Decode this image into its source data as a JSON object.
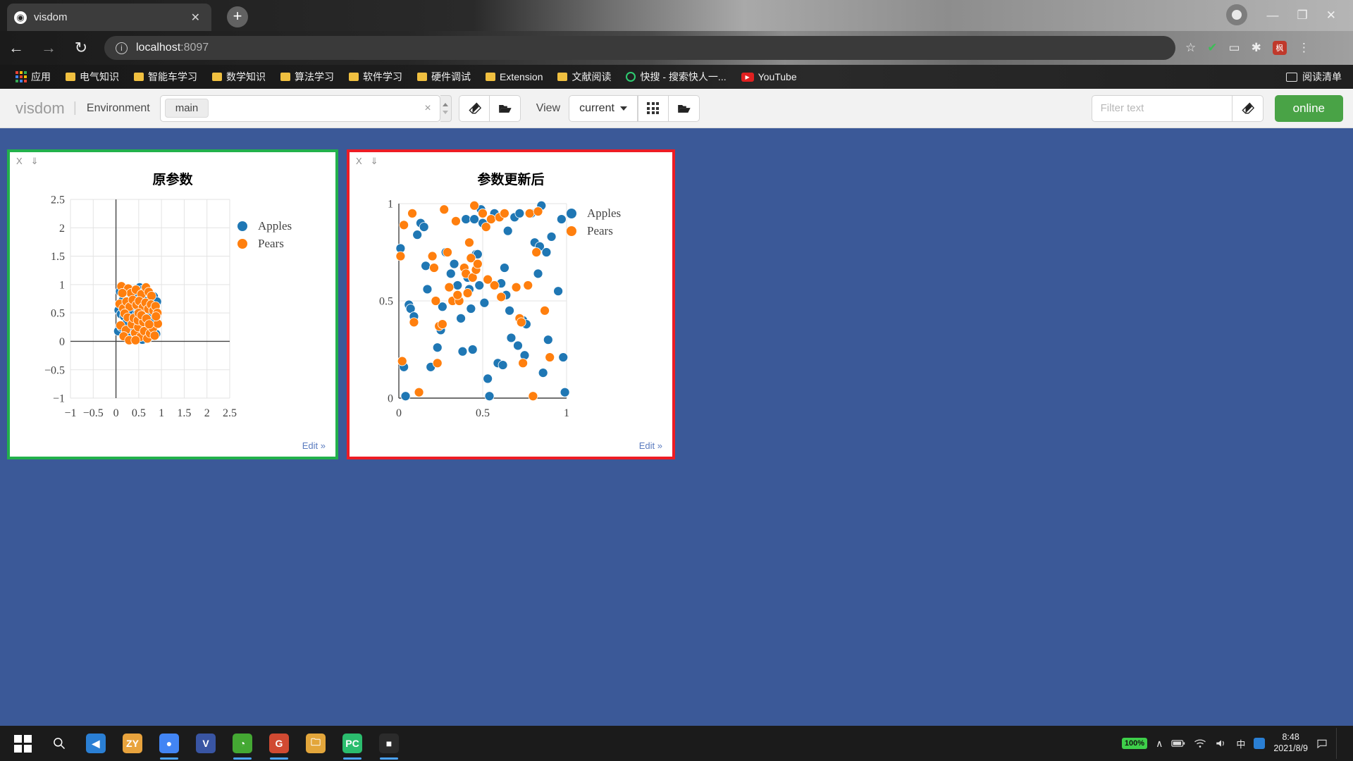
{
  "browser": {
    "tab": {
      "title": "visdom",
      "favicon": "visdom-globe-icon",
      "close": "✕"
    },
    "newtab_label": "+",
    "window_controls": {
      "minimize": "—",
      "maximize": "❐",
      "close": "✕"
    },
    "nav": {
      "back": "←",
      "forward": "→",
      "reload": "↻"
    },
    "omnibox": {
      "info": "ⓘ",
      "host": "localhost",
      "port": ":8097"
    },
    "nav_right": {
      "star": "☆",
      "shield": "✔",
      "cast": "▭",
      "extensions": "✱",
      "profile_badge": "枫",
      "menu": "⋮"
    },
    "bookmarks": [
      {
        "label": "应用",
        "icon": "apps-grid-icon"
      },
      {
        "label": "电气知识",
        "icon": "folder-icon"
      },
      {
        "label": "智能车学习",
        "icon": "folder-icon"
      },
      {
        "label": "数学知识",
        "icon": "folder-icon"
      },
      {
        "label": "算法学习",
        "icon": "folder-icon"
      },
      {
        "label": "软件学习",
        "icon": "folder-icon"
      },
      {
        "label": "硬件调试",
        "icon": "folder-icon"
      },
      {
        "label": "Extension",
        "icon": "folder-icon"
      },
      {
        "label": "文献阅读",
        "icon": "folder-icon"
      },
      {
        "label": "快搜 - 搜索快人一...",
        "icon": "quicksearch-icon"
      },
      {
        "label": "YouTube",
        "icon": "youtube-icon"
      }
    ],
    "reading_list": "阅读清单"
  },
  "visdom": {
    "logo": "visdom",
    "separator": "|",
    "environment_label": "Environment",
    "environment_value": "main",
    "clear_token": "×",
    "eraser_icon": "eraser-icon",
    "folder_icon": "folder-open-icon",
    "view_label": "View",
    "view_value": "current",
    "grid_icon": "grid-icon",
    "view_folder_icon": "folder-open-icon",
    "filter_placeholder": "Filter text",
    "filter_value": "",
    "filter_eraser_icon": "eraser-icon",
    "status_label": "online",
    "status_color": "#49a346"
  },
  "panels": [
    {
      "border_color": "#22b14c",
      "close_label": "X",
      "save_label": "⇓",
      "edit_label": "Edit »",
      "chart_index": 0
    },
    {
      "border_color": "#ed1c24",
      "close_label": "X",
      "save_label": "⇓",
      "edit_label": "Edit »",
      "chart_index": 1
    }
  ],
  "chart_data": [
    {
      "type": "scatter",
      "title": "原参数",
      "xlabel": "",
      "ylabel": "",
      "xlim": [
        -1,
        2.5
      ],
      "ylim": [
        -1,
        2.5
      ],
      "xticks": [
        "−1",
        "−0.5",
        "0",
        "0.5",
        "1",
        "1.5",
        "2",
        "2.5"
      ],
      "yticks": [
        "−1",
        "−0.5",
        "0",
        "0.5",
        "1",
        "1.5",
        "2",
        "2.5"
      ],
      "grid": true,
      "legend_position": "right",
      "legend": [
        {
          "name": "Apples",
          "color": "#1f77b4"
        },
        {
          "name": "Pears",
          "color": "#ff7f0e"
        }
      ],
      "series": [
        {
          "name": "Apples",
          "color": "#1f77b4",
          "points": [
            [
              0.09,
              0.88
            ],
            [
              0.21,
              0.93
            ],
            [
              0.29,
              0.86
            ],
            [
              0.34,
              0.81
            ],
            [
              0.41,
              0.77
            ],
            [
              0.52,
              0.95
            ],
            [
              0.57,
              0.9
            ],
            [
              0.64,
              0.88
            ],
            [
              0.06,
              0.55
            ],
            [
              0.11,
              0.48
            ],
            [
              0.14,
              0.62
            ],
            [
              0.18,
              0.44
            ],
            [
              0.24,
              0.57
            ],
            [
              0.27,
              0.5
            ],
            [
              0.31,
              0.66
            ],
            [
              0.36,
              0.53
            ],
            [
              0.43,
              0.62
            ],
            [
              0.47,
              0.49
            ],
            [
              0.5,
              0.58
            ],
            [
              0.55,
              0.44
            ],
            [
              0.6,
              0.52
            ],
            [
              0.66,
              0.47
            ],
            [
              0.7,
              0.56
            ],
            [
              0.74,
              0.43
            ],
            [
              0.05,
              0.18
            ],
            [
              0.12,
              0.25
            ],
            [
              0.2,
              0.12
            ],
            [
              0.28,
              0.22
            ],
            [
              0.33,
              0.09
            ],
            [
              0.4,
              0.17
            ],
            [
              0.46,
              0.06
            ],
            [
              0.53,
              0.14
            ],
            [
              0.58,
              0.03
            ],
            [
              0.63,
              0.11
            ],
            [
              0.68,
              0.2
            ],
            [
              0.72,
              0.07
            ],
            [
              0.76,
              0.33
            ],
            [
              0.8,
              0.26
            ],
            [
              0.84,
              0.39
            ],
            [
              0.88,
              0.13
            ],
            [
              0.15,
              0.72
            ],
            [
              0.38,
              0.84
            ],
            [
              0.61,
              0.72
            ],
            [
              0.79,
              0.63
            ],
            [
              0.83,
              0.79
            ],
            [
              0.86,
              0.52
            ],
            [
              0.9,
              0.7
            ],
            [
              0.25,
              0.35
            ]
          ]
        },
        {
          "name": "Pears",
          "color": "#ff7f0e",
          "points": [
            [
              0.12,
              0.97
            ],
            [
              0.27,
              0.93
            ],
            [
              0.33,
              0.85
            ],
            [
              0.44,
              0.91
            ],
            [
              0.56,
              0.83
            ],
            [
              0.66,
              0.95
            ],
            [
              0.72,
              0.87
            ],
            [
              0.78,
              0.8
            ],
            [
              0.08,
              0.66
            ],
            [
              0.16,
              0.58
            ],
            [
              0.23,
              0.7
            ],
            [
              0.3,
              0.61
            ],
            [
              0.37,
              0.73
            ],
            [
              0.45,
              0.64
            ],
            [
              0.51,
              0.71
            ],
            [
              0.59,
              0.6
            ],
            [
              0.65,
              0.68
            ],
            [
              0.71,
              0.57
            ],
            [
              0.77,
              0.65
            ],
            [
              0.82,
              0.54
            ],
            [
              0.87,
              0.62
            ],
            [
              0.91,
              0.5
            ],
            [
              0.19,
              0.49
            ],
            [
              0.26,
              0.42
            ],
            [
              0.1,
              0.28
            ],
            [
              0.22,
              0.2
            ],
            [
              0.35,
              0.3
            ],
            [
              0.42,
              0.15
            ],
            [
              0.49,
              0.25
            ],
            [
              0.54,
              0.08
            ],
            [
              0.62,
              0.18
            ],
            [
              0.69,
              0.05
            ],
            [
              0.75,
              0.14
            ],
            [
              0.81,
              0.23
            ],
            [
              0.85,
              0.1
            ],
            [
              0.92,
              0.31
            ],
            [
              0.17,
              0.09
            ],
            [
              0.39,
              0.41
            ],
            [
              0.48,
              0.37
            ],
            [
              0.6,
              0.34
            ],
            [
              0.14,
              0.85
            ],
            [
              0.5,
              0.5
            ],
            [
              0.56,
              0.46
            ],
            [
              0.67,
              0.4
            ],
            [
              0.73,
              0.3
            ],
            [
              0.88,
              0.44
            ],
            [
              0.29,
              0.02
            ],
            [
              0.43,
              0.02
            ]
          ]
        }
      ]
    },
    {
      "type": "scatter",
      "title": "参数更新后",
      "xlabel": "",
      "ylabel": "",
      "xlim": [
        0,
        1
      ],
      "ylim": [
        0,
        1
      ],
      "xticks": [
        "0",
        "0.5",
        "1"
      ],
      "yticks": [
        "0",
        "0.5",
        "1"
      ],
      "grid": true,
      "legend_position": "right",
      "legend": [
        {
          "name": "Apples",
          "color": "#1f77b4"
        },
        {
          "name": "Pears",
          "color": "#ff7f0e"
        }
      ],
      "series": [
        {
          "name": "Apples",
          "color": "#1f77b4",
          "points": [
            [
              0.01,
              0.77
            ],
            [
              0.03,
              0.16
            ],
            [
              0.04,
              0.01
            ],
            [
              0.06,
              0.48
            ],
            [
              0.07,
              0.46
            ],
            [
              0.09,
              0.42
            ],
            [
              0.11,
              0.84
            ],
            [
              0.13,
              0.9
            ],
            [
              0.15,
              0.88
            ],
            [
              0.16,
              0.68
            ],
            [
              0.17,
              0.56
            ],
            [
              0.19,
              0.16
            ],
            [
              0.23,
              0.26
            ],
            [
              0.26,
              0.47
            ],
            [
              0.28,
              0.75
            ],
            [
              0.31,
              0.64
            ],
            [
              0.35,
              0.58
            ],
            [
              0.37,
              0.41
            ],
            [
              0.38,
              0.24
            ],
            [
              0.4,
              0.92
            ],
            [
              0.41,
              0.62
            ],
            [
              0.42,
              0.56
            ],
            [
              0.43,
              0.46
            ],
            [
              0.44,
              0.25
            ],
            [
              0.45,
              0.92
            ],
            [
              0.46,
              0.74
            ],
            [
              0.47,
              0.74
            ],
            [
              0.48,
              0.58
            ],
            [
              0.49,
              0.97
            ],
            [
              0.5,
              0.9
            ],
            [
              0.51,
              0.49
            ],
            [
              0.53,
              0.1
            ],
            [
              0.54,
              0.01
            ],
            [
              0.57,
              0.95
            ],
            [
              0.59,
              0.18
            ],
            [
              0.61,
              0.59
            ],
            [
              0.62,
              0.17
            ],
            [
              0.63,
              0.67
            ],
            [
              0.64,
              0.53
            ],
            [
              0.65,
              0.86
            ],
            [
              0.66,
              0.45
            ],
            [
              0.67,
              0.31
            ],
            [
              0.69,
              0.93
            ],
            [
              0.71,
              0.27
            ],
            [
              0.72,
              0.95
            ],
            [
              0.74,
              0.4
            ],
            [
              0.75,
              0.22
            ],
            [
              0.76,
              0.38
            ],
            [
              0.79,
              0.95
            ],
            [
              0.81,
              0.8
            ],
            [
              0.83,
              0.64
            ],
            [
              0.84,
              0.78
            ],
            [
              0.85,
              0.99
            ],
            [
              0.86,
              0.13
            ],
            [
              0.88,
              0.75
            ],
            [
              0.89,
              0.3
            ],
            [
              0.91,
              0.83
            ],
            [
              0.95,
              0.55
            ],
            [
              0.97,
              0.92
            ],
            [
              0.98,
              0.21
            ],
            [
              0.99,
              0.03
            ],
            [
              0.22,
              0.5
            ],
            [
              0.25,
              0.35
            ],
            [
              0.33,
              0.69
            ]
          ]
        },
        {
          "name": "Pears",
          "color": "#ff7f0e",
          "points": [
            [
              0.01,
              0.73
            ],
            [
              0.02,
              0.19
            ],
            [
              0.03,
              0.89
            ],
            [
              0.08,
              0.95
            ],
            [
              0.09,
              0.39
            ],
            [
              0.12,
              0.03
            ],
            [
              0.2,
              0.73
            ],
            [
              0.21,
              0.67
            ],
            [
              0.22,
              0.5
            ],
            [
              0.23,
              0.18
            ],
            [
              0.24,
              0.37
            ],
            [
              0.26,
              0.38
            ],
            [
              0.27,
              0.97
            ],
            [
              0.29,
              0.75
            ],
            [
              0.3,
              0.57
            ],
            [
              0.32,
              0.5
            ],
            [
              0.34,
              0.91
            ],
            [
              0.36,
              0.5
            ],
            [
              0.39,
              0.67
            ],
            [
              0.4,
              0.64
            ],
            [
              0.41,
              0.54
            ],
            [
              0.42,
              0.8
            ],
            [
              0.43,
              0.72
            ],
            [
              0.44,
              0.62
            ],
            [
              0.45,
              0.99
            ],
            [
              0.46,
              0.66
            ],
            [
              0.47,
              0.69
            ],
            [
              0.5,
              0.95
            ],
            [
              0.52,
              0.88
            ],
            [
              0.55,
              0.92
            ],
            [
              0.57,
              0.58
            ],
            [
              0.6,
              0.93
            ],
            [
              0.61,
              0.52
            ],
            [
              0.63,
              0.95
            ],
            [
              0.7,
              0.57
            ],
            [
              0.72,
              0.41
            ],
            [
              0.73,
              0.39
            ],
            [
              0.74,
              0.18
            ],
            [
              0.77,
              0.58
            ],
            [
              0.78,
              0.95
            ],
            [
              0.8,
              0.01
            ],
            [
              0.82,
              0.75
            ],
            [
              0.83,
              0.96
            ],
            [
              0.87,
              0.45
            ],
            [
              0.9,
              0.21
            ],
            [
              0.35,
              0.53
            ],
            [
              0.53,
              0.61
            ]
          ]
        }
      ]
    }
  ],
  "taskbar": {
    "start_icon": "windows-logo-icon",
    "search_icon": "search-icon",
    "apps": [
      {
        "name": "vs-code-icon",
        "glyph": "◀",
        "color": "#2a7fd4",
        "active": false
      },
      {
        "name": "zy-player-icon",
        "glyph": "ZY",
        "color": "#e8a33d",
        "active": false
      },
      {
        "name": "chrome-icon",
        "glyph": "●",
        "color": "#4285f4",
        "active": true
      },
      {
        "name": "visio-icon",
        "glyph": "V",
        "color": "#3955a3",
        "active": false
      },
      {
        "name": "anaconda-icon",
        "glyph": "◔",
        "color": "#44a833",
        "active": true
      },
      {
        "name": "pdf-reader-icon",
        "glyph": "G",
        "color": "#d04a32",
        "active": true
      },
      {
        "name": "file-explorer-icon",
        "glyph": "🗀",
        "color": "#e3a63b",
        "active": false
      },
      {
        "name": "pycharm-icon",
        "glyph": "PC",
        "color": "#2bbd6e",
        "active": true
      },
      {
        "name": "terminal-icon",
        "glyph": "■",
        "color": "#2b2b2b",
        "active": true
      }
    ],
    "tray": {
      "chevron": "∧",
      "battery_percent": "100%",
      "icons": [
        "battery-icon",
        "wifi-icon",
        "volume-icon",
        "ime-icon",
        "sogou-icon"
      ],
      "time": "8:48",
      "date": "2021/8/9",
      "notification_icon": "notification-icon"
    }
  }
}
